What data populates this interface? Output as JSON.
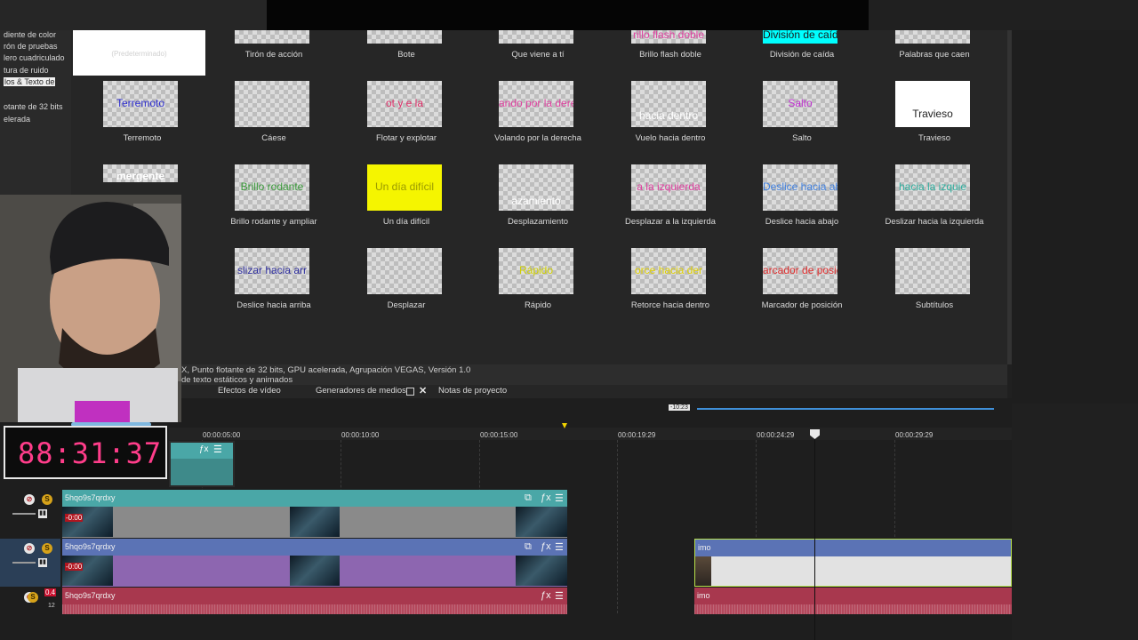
{
  "categories": [
    {
      "label": "diente de color",
      "selected": false
    },
    {
      "label": "rón de pruebas",
      "selected": false
    },
    {
      "label": "lero cuadriculado",
      "selected": false
    },
    {
      "label": "tura de ruido",
      "selected": false
    },
    {
      "label": "los & Texto de",
      "selected": true
    },
    {
      "label": "otante de 32 bits",
      "selected": false
    },
    {
      "label": "elerada",
      "selected": false
    }
  ],
  "default_preview_label": "(Predeterminado)",
  "presets": [
    {
      "caption": "Tirón de acción",
      "thumb_text": "",
      "thumb_color": ""
    },
    {
      "caption": "Bote",
      "thumb_text": "",
      "thumb_color": ""
    },
    {
      "caption": "Que viene a tí",
      "thumb_text": "",
      "thumb_color": ""
    },
    {
      "caption": "Brillo flash doble",
      "thumb_text": "rillo flash doble",
      "thumb_color": "#e040a0"
    },
    {
      "caption": "División de caída",
      "thumb_text": "División de caíd",
      "thumb_color": "#1a1a1a"
    },
    {
      "caption": "Palabras que caen",
      "thumb_text": "",
      "thumb_color": ""
    },
    {
      "caption": "Terremoto",
      "thumb_text": "Terremoto",
      "thumb_color": "#3030d0"
    },
    {
      "caption": "Cáese",
      "thumb_text": "",
      "thumb_color": "#30b0b0"
    },
    {
      "caption": "Flotar y explotar",
      "thumb_text": "ot   y   e      la",
      "thumb_color": "#e0306a"
    },
    {
      "caption": "Volando por la derecha",
      "thumb_text": "ando por la dere",
      "thumb_color": "#e040a0"
    },
    {
      "caption": "Vuelo hacia dentro",
      "thumb_text": "hacia dentro",
      "thumb_color": "#ffffff"
    },
    {
      "caption": "Salto",
      "thumb_text": "Salto",
      "thumb_color": "#c030d0"
    },
    {
      "caption": "Travieso",
      "thumb_text": "Travieso",
      "thumb_color": "#222222"
    },
    {
      "caption": "",
      "thumb_text": "mergente",
      "thumb_color": "#ffffff"
    },
    {
      "caption": "Brillo rodante y ampliar",
      "thumb_text": "Brillo rodante",
      "thumb_color": "#3a9a3a"
    },
    {
      "caption": "Un día difícil",
      "thumb_text": "Un día difícil",
      "thumb_color": "#9a9a00"
    },
    {
      "caption": "Desplazamiento",
      "thumb_text": "azamiento",
      "thumb_color": "#ffffff"
    },
    {
      "caption": "Desplazar a la izquierda",
      "thumb_text": "a la izquierda",
      "thumb_color": "#e040a0"
    },
    {
      "caption": "Deslice hacia abajo",
      "thumb_text": "Deslice hacia abajo",
      "thumb_color": "#4080e0"
    },
    {
      "caption": "Deslizar hacia la izquierda",
      "thumb_text": "hacia la izquie",
      "thumb_color": "#30b0a0"
    },
    {
      "caption": "Deslice hacia arriba",
      "thumb_text": "slizar hacia arr",
      "thumb_color": "#3030a0"
    },
    {
      "caption": "Desplazar",
      "thumb_text": "",
      "thumb_color": ""
    },
    {
      "caption": "Rápido",
      "thumb_text": "Rápido",
      "thumb_color": "#d0d000"
    },
    {
      "caption": "Retorce hacia dentro",
      "thumb_text": "orce hacia der",
      "thumb_color": "#e0d000"
    },
    {
      "caption": "Marcador de posición",
      "thumb_text": "arcador de posic",
      "thumb_color": "#e03030"
    },
    {
      "caption": "Subtítulos",
      "thumb_text": "",
      "thumb_color": ""
    }
  ],
  "description": {
    "line1": "X, Punto flotante de 32 bits, GPU acelerada, Agrupación VEGAS, Versión 1.0",
    "line2": "de texto estáticos y animados"
  },
  "tabs": {
    "video_effects": "Efectos de vídeo",
    "media_generators": "Generadores de medios",
    "project_notes": "Notas de proyecto"
  },
  "timecode": "88:31:37",
  "zoom_label": "-10:23",
  "ruler": [
    "00:00:05:00",
    "00:00:10:00",
    "00:00:15:00",
    "00:00:19:29",
    "00:00:24:29",
    "00:00:29:29"
  ],
  "tracks": {
    "t1_clip_name": "5hqo9s7qrdxy",
    "t2_clip_name": "5hqo9s7qrdxy",
    "t3_clip_name": "5hqo9s7qrdxy",
    "t2_right_clip_name": "imo",
    "t3_right_clip_name": "imo",
    "fade_label": "-0:00",
    "audio_db": "0.4",
    "audio_num": "12"
  },
  "colors": {
    "track1": "#4aa7a7",
    "track2": "#5b73b5",
    "track2_body": "#8d66b0",
    "track3": "#a8384e",
    "timecode": "#ff3d8a",
    "accent_blue": "#3f8fd8"
  }
}
